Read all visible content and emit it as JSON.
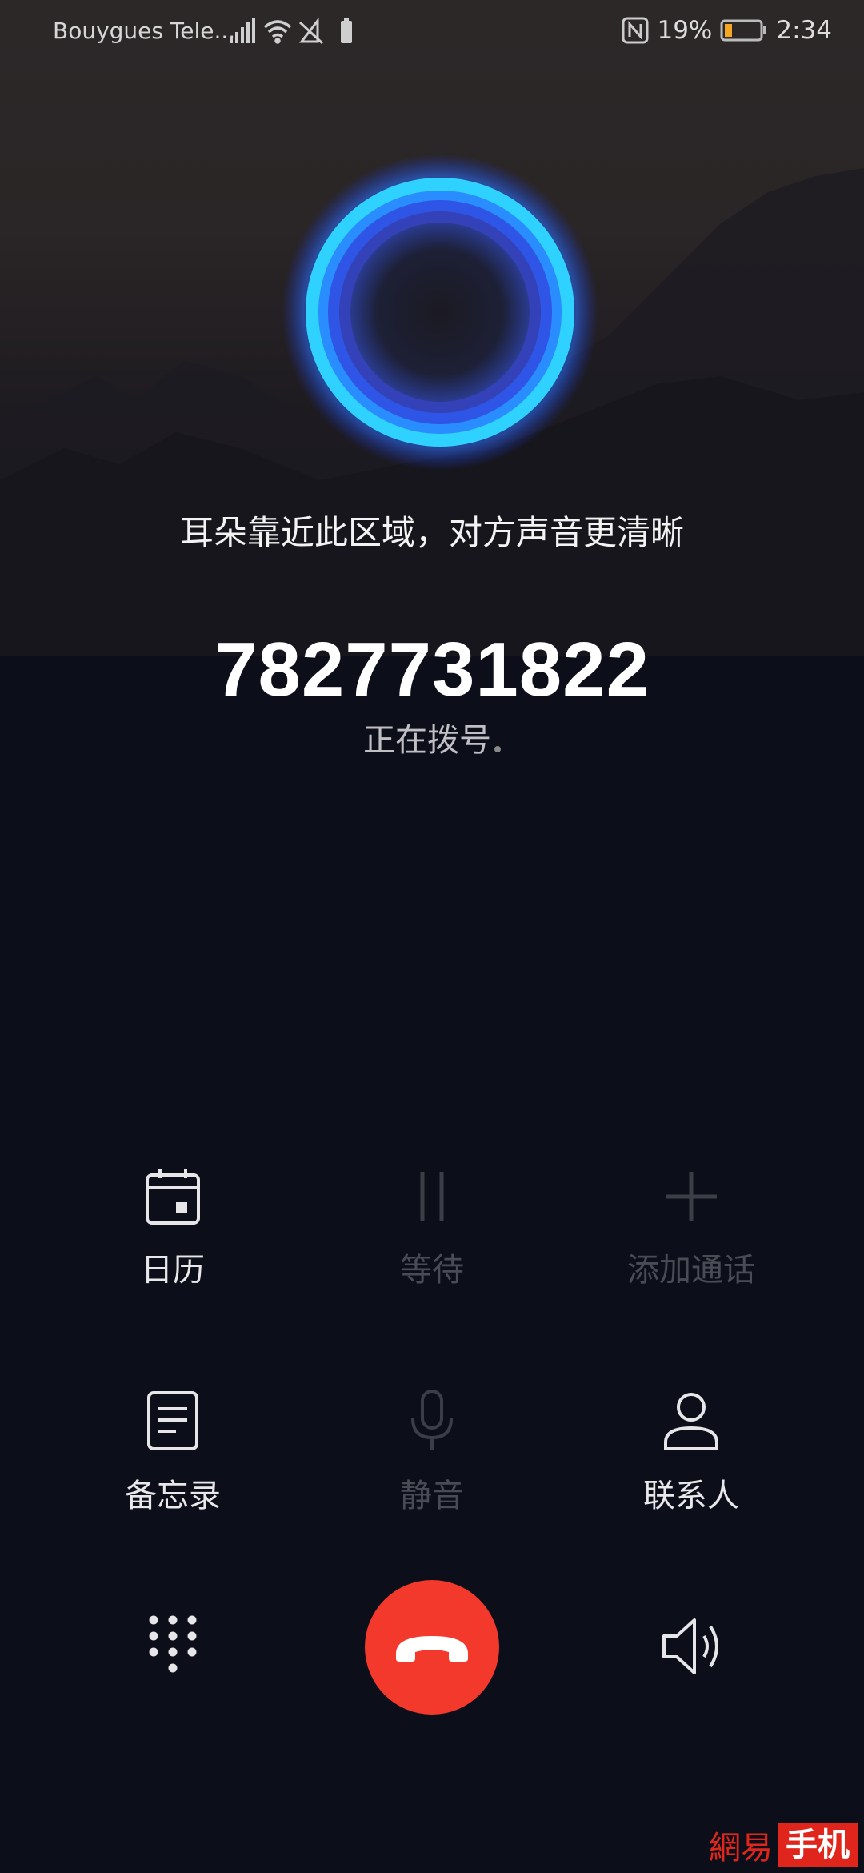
{
  "status_bar": {
    "carrier": "Bouygues Tele...",
    "battery_percent": "19%",
    "time": "2:34",
    "icons": [
      "signal-icon",
      "wifi-icon",
      "data-saver-icon",
      "battery-saver-icon",
      "nfc-icon",
      "battery-icon"
    ]
  },
  "hint": "耳朵靠近此区域，对方声音更清晰",
  "call": {
    "number": "7827731822",
    "status": "正在拨号"
  },
  "actions": [
    {
      "label": "日历",
      "icon": "calendar-icon",
      "enabled": true
    },
    {
      "label": "等待",
      "icon": "pause-icon",
      "enabled": false
    },
    {
      "label": "添加通话",
      "icon": "plus-icon",
      "enabled": false
    },
    {
      "label": "备忘录",
      "icon": "notes-icon",
      "enabled": true
    },
    {
      "label": "静音",
      "icon": "microphone-icon",
      "enabled": false
    },
    {
      "label": "联系人",
      "icon": "contact-icon",
      "enabled": true
    }
  ],
  "bottom_bar": {
    "icons": [
      "dialpad-icon",
      "end-call-icon",
      "speaker-icon"
    ]
  },
  "colors": {
    "end_call": "#f2392b",
    "orb_accent": "#2fd2ff",
    "background": "#0c0e19"
  },
  "watermark": {
    "left": "網易",
    "right": "手机"
  }
}
